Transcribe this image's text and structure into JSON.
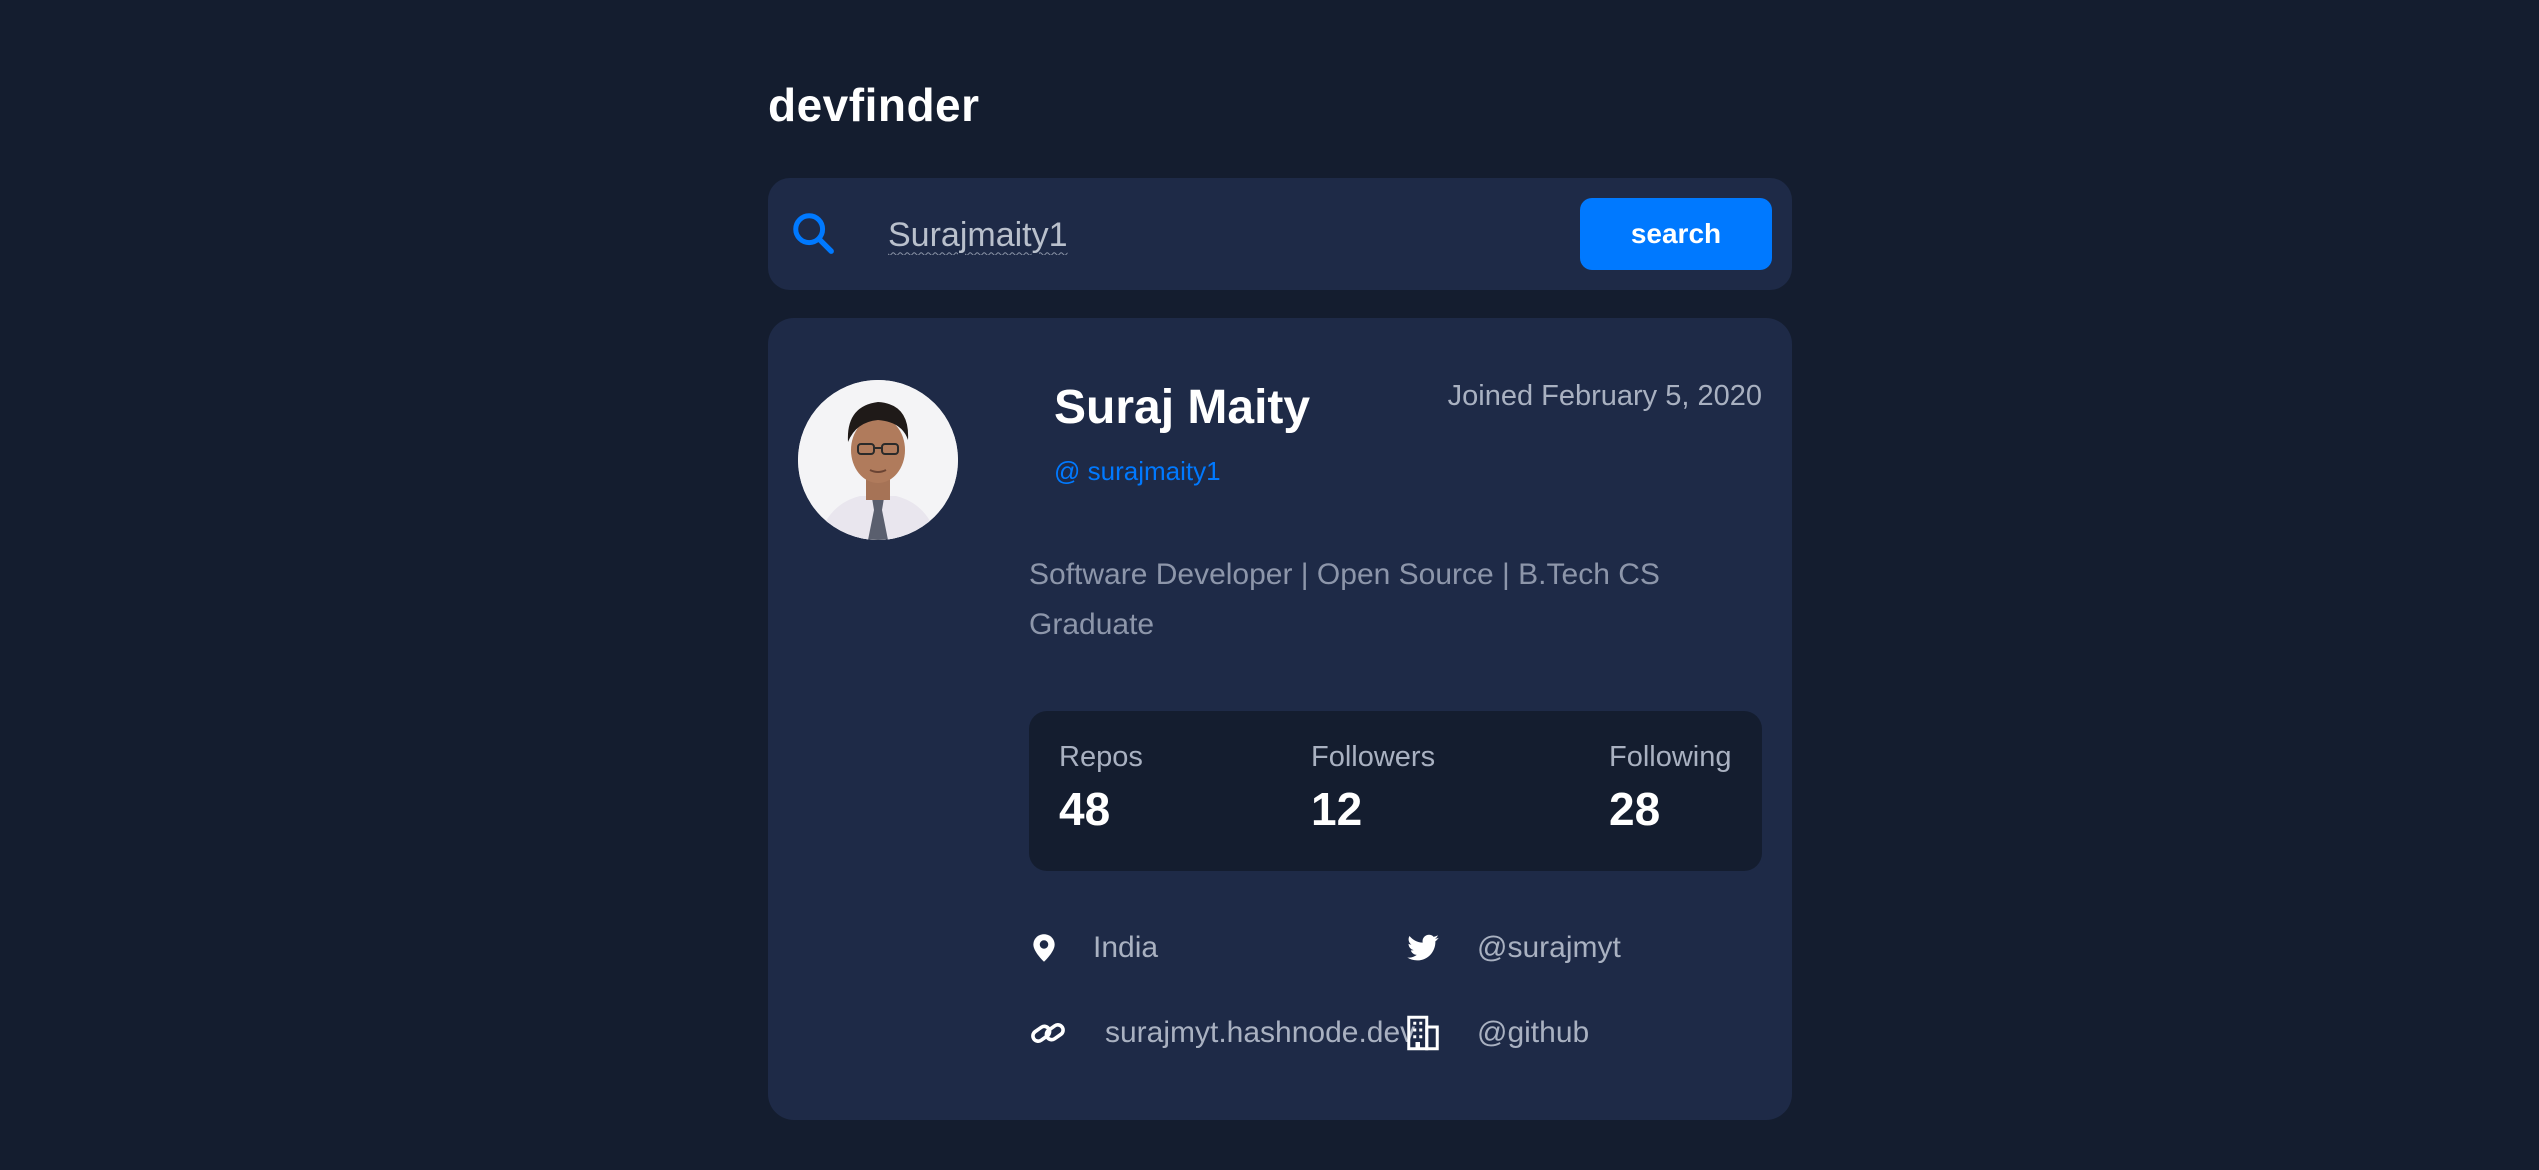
{
  "app": {
    "title": "devfinder"
  },
  "search": {
    "value": "Surajmaity1",
    "button_label": "search",
    "icon": "search-icon"
  },
  "profile": {
    "name": "Suraj Maity",
    "handle": "@ surajmaity1",
    "joined": "Joined February 5, 2020",
    "bio": "Software Developer | Open Source | B.Tech CS Graduate",
    "stats": [
      {
        "label": "Repos",
        "value": "48"
      },
      {
        "label": "Followers",
        "value": "12"
      },
      {
        "label": "Following",
        "value": "28"
      }
    ],
    "links": {
      "location": {
        "icon": "location-pin-icon",
        "text": "India"
      },
      "twitter": {
        "icon": "twitter-icon",
        "text": "@surajmyt"
      },
      "website": {
        "icon": "link-icon",
        "text": "surajmyt.hashnode.dev"
      },
      "company": {
        "icon": "building-icon",
        "text": "@github"
      }
    }
  },
  "colors": {
    "background": "#141d2f",
    "card": "#1e2a47",
    "accent": "#0079ff",
    "text": "#ffffff",
    "muted": "#a9b1c1"
  }
}
